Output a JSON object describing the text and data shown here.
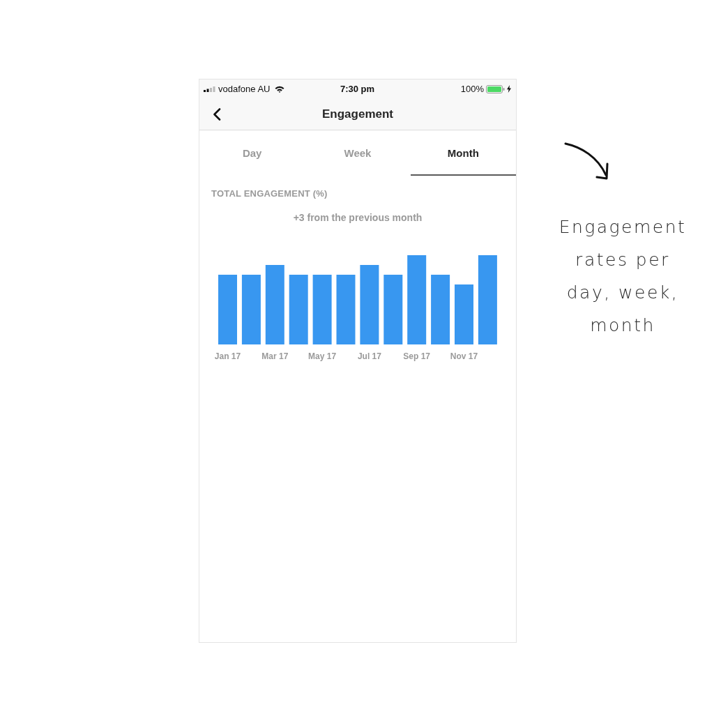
{
  "status_bar": {
    "carrier": "vodafone AU",
    "time": "7:30 pm",
    "battery": "100%"
  },
  "header": {
    "title": "Engagement"
  },
  "tabs": [
    {
      "label": "Day",
      "selected": false
    },
    {
      "label": "Week",
      "selected": false
    },
    {
      "label": "Month",
      "selected": true
    }
  ],
  "section": {
    "title": "TOTAL ENGAGEMENT (%)",
    "summary": "+3 from the previous month",
    "x_labels": [
      "Jan 17",
      "Mar 17",
      "May 17",
      "Jul 17",
      "Sep 17",
      "Nov 17"
    ]
  },
  "annotation": {
    "text": "Engagement rates per day, week, month"
  }
}
